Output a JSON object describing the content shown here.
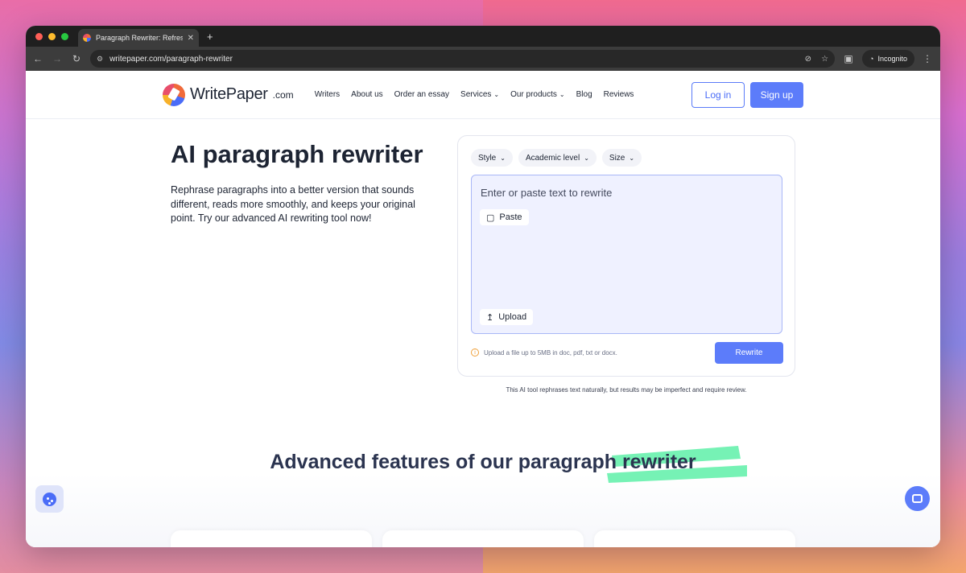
{
  "browser": {
    "tab_title": "Paragraph Rewriter: Refresh",
    "tab_close": "✕",
    "new_tab": "+",
    "url": "writepaper.com/paragraph-rewriter",
    "incognito_label": "Incognito"
  },
  "header": {
    "logo_text": "WritePaper",
    "logo_domain": ".com",
    "nav": [
      {
        "label": "Writers",
        "has_dropdown": false
      },
      {
        "label": "About us",
        "has_dropdown": false
      },
      {
        "label": "Order an essay",
        "has_dropdown": false
      },
      {
        "label": "Services",
        "has_dropdown": true
      },
      {
        "label": "Our products",
        "has_dropdown": true
      },
      {
        "label": "Blog",
        "has_dropdown": false
      },
      {
        "label": "Reviews",
        "has_dropdown": false
      }
    ],
    "login_label": "Log in",
    "signup_label": "Sign up"
  },
  "hero": {
    "title": "AI paragraph rewriter",
    "description": "Rephrase paragraphs into a better version that sounds different, reads more smoothly, and keeps your original point. Try our advanced AI rewriting tool now!"
  },
  "tool": {
    "options": [
      "Style",
      "Academic level",
      "Size"
    ],
    "placeholder": "Enter or paste text to rewrite",
    "paste_label": "Paste",
    "upload_label": "Upload",
    "hint": "Upload a file up to 5MB in doc, pdf, txt or docx.",
    "rewrite_label": "Rewrite",
    "disclaimer": "This AI tool rephrases text naturally, but results may be imperfect and require review."
  },
  "features": {
    "title": "Advanced features of our paragraph rewriter"
  },
  "colors": {
    "accent": "#5c7cfa",
    "textarea_bg": "#eff1ff",
    "highlight": "#5ef0a8",
    "text_dark": "#1d2433"
  }
}
